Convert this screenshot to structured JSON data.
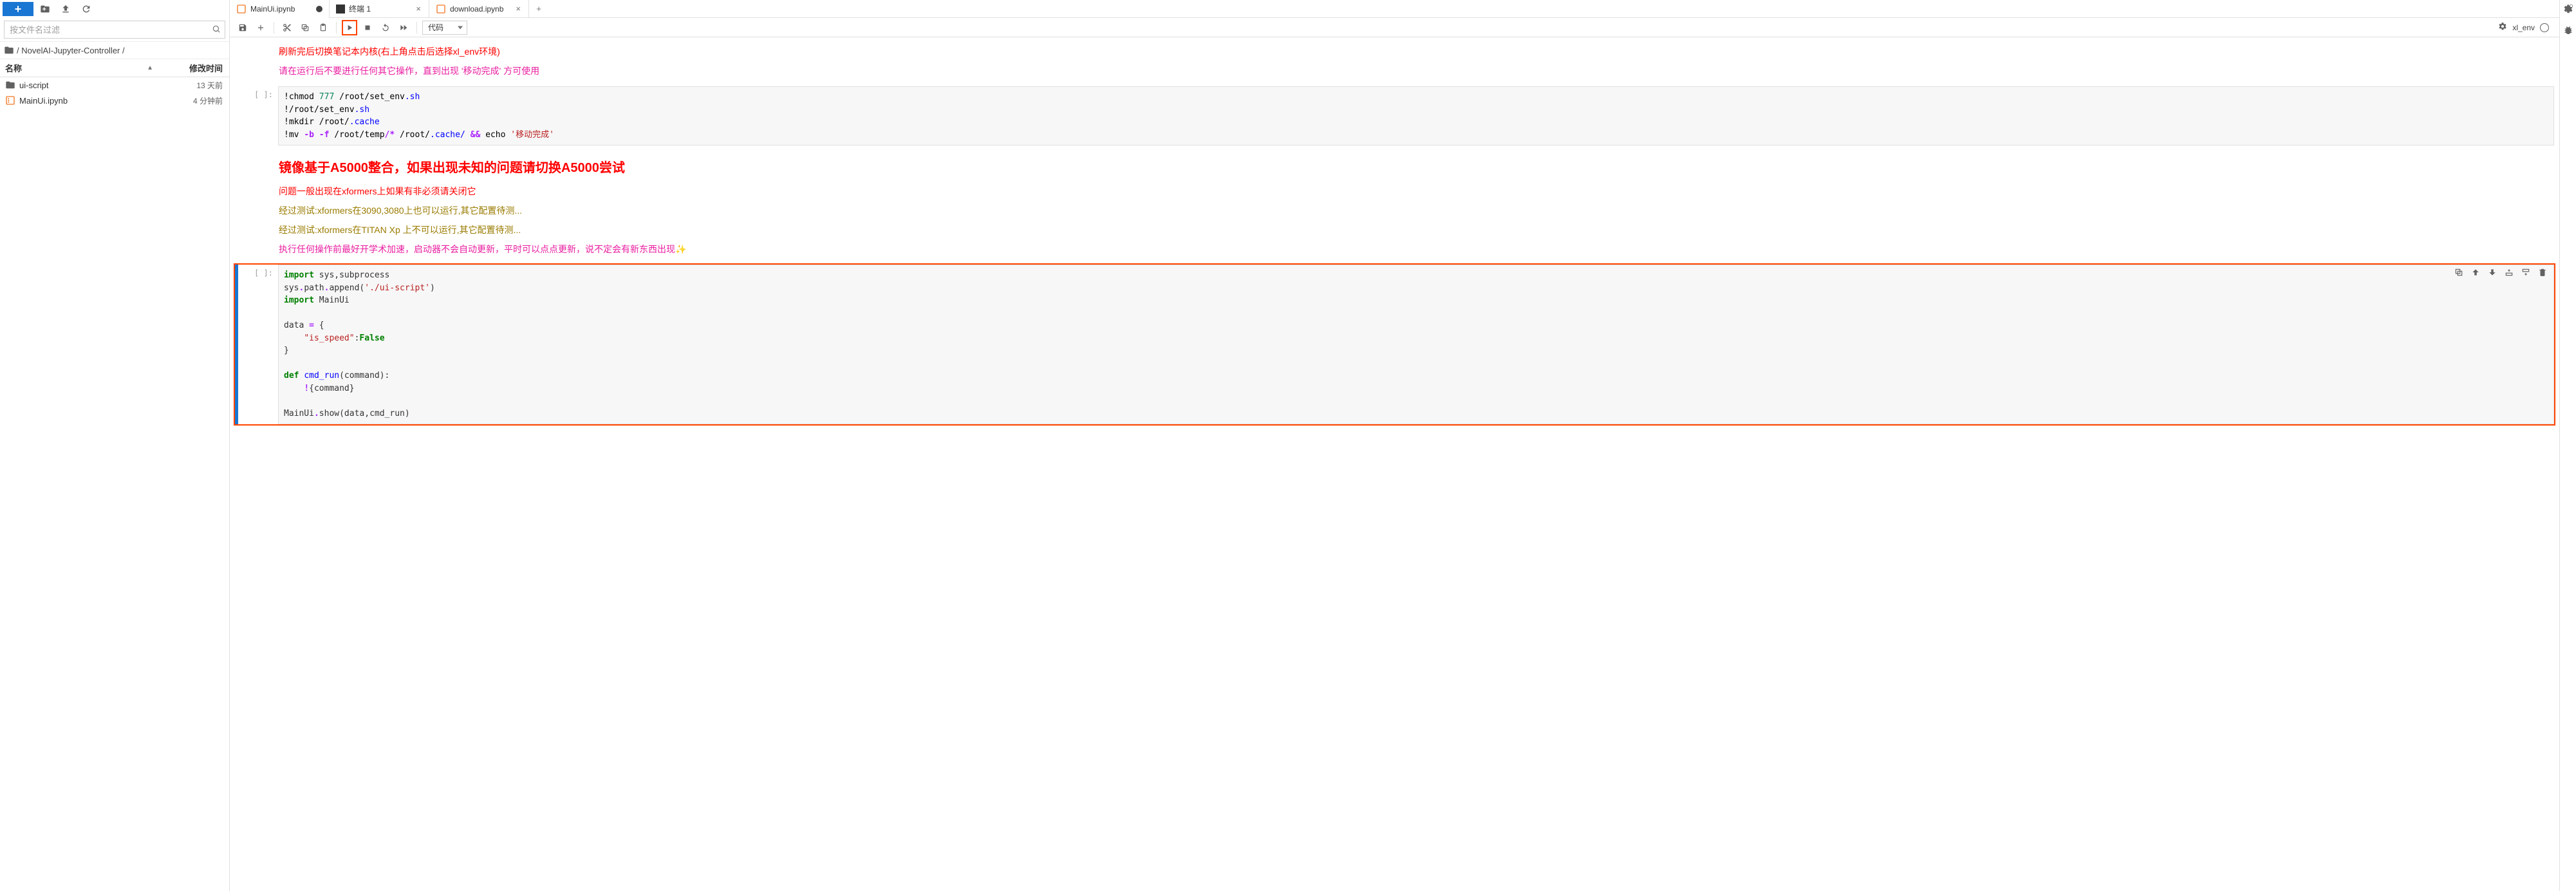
{
  "sidebar": {
    "filter_placeholder": "按文件名过滤",
    "breadcrumb": "/ NovelAI-Jupyter-Controller /",
    "col_name": "名称",
    "col_modified": "修改时间",
    "files": [
      {
        "name": "ui-script",
        "modified": "13 天前",
        "type": "folder"
      },
      {
        "name": "MainUi.ipynb",
        "modified": "4 分钟前",
        "type": "notebook"
      }
    ]
  },
  "tabs": {
    "items": [
      {
        "label": "MainUi.ipynb",
        "icon": "notebook",
        "dirty": true
      },
      {
        "label": "终端 1",
        "icon": "terminal",
        "dirty": false
      },
      {
        "label": "download.ipynb",
        "icon": "notebook",
        "dirty": false
      }
    ]
  },
  "toolbar": {
    "celltype": "代码"
  },
  "kernel": {
    "name": "xl_env"
  },
  "markdown": {
    "m1": "刷新完后切换笔记本内核(右上角点击后选择xl_env环境)",
    "m2": "请在运行后不要进行任何其它操作，直到出现 '移动完成' 方可使用",
    "m3": "镜像基于A5000整合，如果出现未知的问题请切换A5000尝试",
    "m4": "问题一般出现在xformers上如果有非必须请关闭它",
    "m5a": "经过测试:xformers在3090,3080上也可以运行,其它配置待测...",
    "m5b": "经过测试:xformers在TITAN Xp 上不可以运行,其它配置待测...",
    "m6": "执行任何操作前最好开学术加速，启动器不会自动更新，平时可以点点更新，说不定会有新东西出现✨"
  },
  "cells": {
    "prompt": "[ ]:",
    "c1_l1": "!chmod 777 /root/set_env.sh",
    "c1_l2": "!/root/set_env.sh",
    "c1_l3": "!mkdir /root/.cache",
    "c1_l4_a": "!mv -b -f /root/temp/* /root/.cache/ && echo ",
    "c1_l4_b": "'移动完成'",
    "c2_l1": "import sys,subprocess",
    "c2_l2": "sys.path.append('./ui-script')",
    "c2_l3": "import MainUi",
    "c2_l4": "",
    "c2_l5a": "data = {",
    "c2_l5b": "    \"is_speed\":False",
    "c2_l5c": "}",
    "c2_l6": "",
    "c2_l7a": "def cmd_run(command):",
    "c2_l7b": "    !{command}",
    "c2_l8": "",
    "c2_l9": "MainUi.show(data,cmd_run)"
  }
}
